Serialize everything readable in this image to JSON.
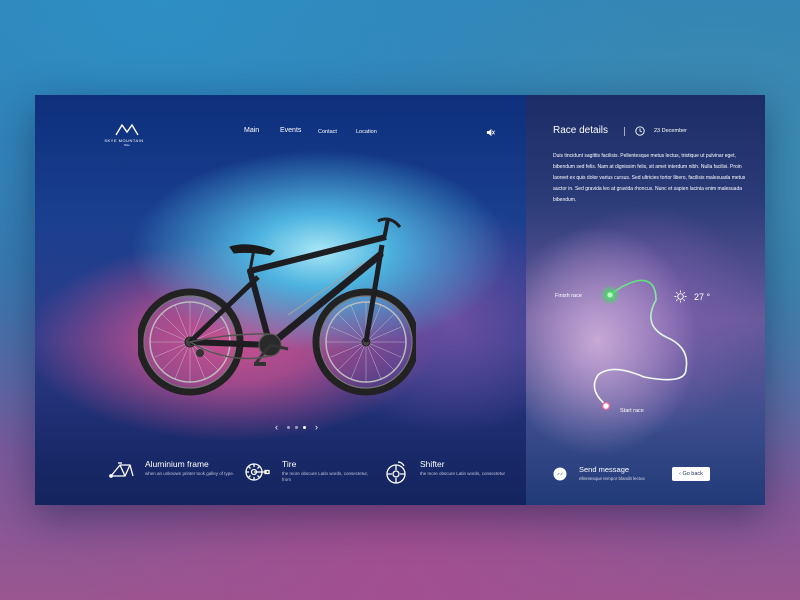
{
  "brand": {
    "name": "SKYE MOUNTAIN",
    "sub": "Bike"
  },
  "nav": {
    "main": "Main",
    "events": "Events",
    "contact": "Contact",
    "location": "Location"
  },
  "icons": {
    "mute": "speaker-muted-icon",
    "clock": "clock-icon",
    "weather": "sun-icon",
    "message": "messenger-icon"
  },
  "carousel": {
    "prev": "‹",
    "next": "›",
    "active_index": 2,
    "count": 3
  },
  "features": [
    {
      "title": "Aluminium frame",
      "desc": "when an unknown printer took galley of type.",
      "icon": "bike-frame-icon"
    },
    {
      "title": "Tire",
      "desc": "the more obscure Latin words, consectetur, from",
      "icon": "chainring-icon"
    },
    {
      "title": "Shifter",
      "desc": "the more obscure Latin words, consectetur",
      "icon": "disc-brake-icon"
    }
  ],
  "race": {
    "title": "Race details",
    "date": "23 December",
    "body": "Duis tincidunt sagittis facilisis. Pellentesque metus lectus, tristique ut pulvinar eget, bibendum sed felis. Nam at dignissim felis, sit amet interdum nibh. Nulla facilisi. Proin laoreet ex quis dolor varius cursus. Sed ultricies tortor libero, facilisis malesuada metus auctor in. Sed gravida leo at gravida rhoncus. Nunc et sapien lacinia enim malesuada bibendum.",
    "finish_label": "Finish race",
    "start_label": "Start race",
    "temperature": "27 °"
  },
  "message": {
    "title": "Send message",
    "sub": "ellentesque tempor blandit lectus",
    "back": "Go back"
  },
  "colors": {
    "accent_green": "#5fe07a",
    "route_start": "#e06aa0",
    "white": "#ffffff"
  }
}
